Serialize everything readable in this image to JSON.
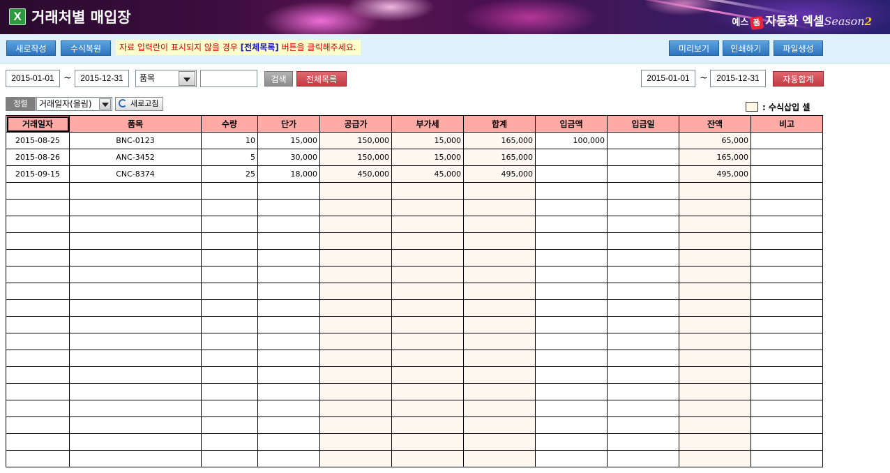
{
  "banner": {
    "app_icon": "excel-icon",
    "title": "거래처별 매입장",
    "brand_prefix": "예스",
    "brand_plus": "폼",
    "brand_name": "자동화 엑셀",
    "brand_season": "Season",
    "brand_season_num": "2"
  },
  "toolbar": {
    "new_label": "새로작성",
    "restore_label": "수식복원",
    "notice_pre": "자료 입력란이 표시되지  않을 경우 ",
    "notice_highlight": "[전체목록]",
    "notice_post": " 버튼을 클릭해주세요.",
    "preview_label": "미리보기",
    "print_label": "인쇄하기",
    "file_label": "파일생성"
  },
  "filter": {
    "start_date": "2015-01-01",
    "end_date": "2015-12-31",
    "tilde": "~",
    "field_value": "품목",
    "search_value": "",
    "search_label": "검색",
    "all_list_label": "전체목록",
    "sum_start_date": "2015-01-01",
    "sum_end_date": "2015-12-31",
    "auto_sum_label": "자동합계"
  },
  "sort": {
    "label": "정렬",
    "value": "거래일자(올림)",
    "refresh_label": "새로고침"
  },
  "legend": {
    "label": ": 수식삽입 셀",
    "formula_cell_color": "#fff8f0"
  },
  "colors": {
    "header_bg": "#ffaaa5",
    "button_blue": "#2f74bf",
    "button_red": "#c23a42",
    "toolbar_bg": "#dff1fa"
  },
  "table": {
    "columns": [
      "거래일자",
      "품목",
      "수량",
      "단가",
      "공급가",
      "부가세",
      "합계",
      "입금액",
      "입금일",
      "잔액",
      "비고"
    ],
    "rows": [
      [
        "2015-08-25",
        "BNC-0123",
        "10",
        "15,000",
        "150,000",
        "15,000",
        "165,000",
        "100,000",
        "",
        "65,000",
        ""
      ],
      [
        "2015-08-26",
        "ANC-3452",
        "5",
        "30,000",
        "150,000",
        "15,000",
        "165,000",
        "",
        "",
        "165,000",
        ""
      ],
      [
        "2015-09-15",
        "CNC-8374",
        "25",
        "18,000",
        "450,000",
        "45,000",
        "495,000",
        "",
        "",
        "495,000",
        ""
      ]
    ],
    "empty_row_count": 17
  }
}
